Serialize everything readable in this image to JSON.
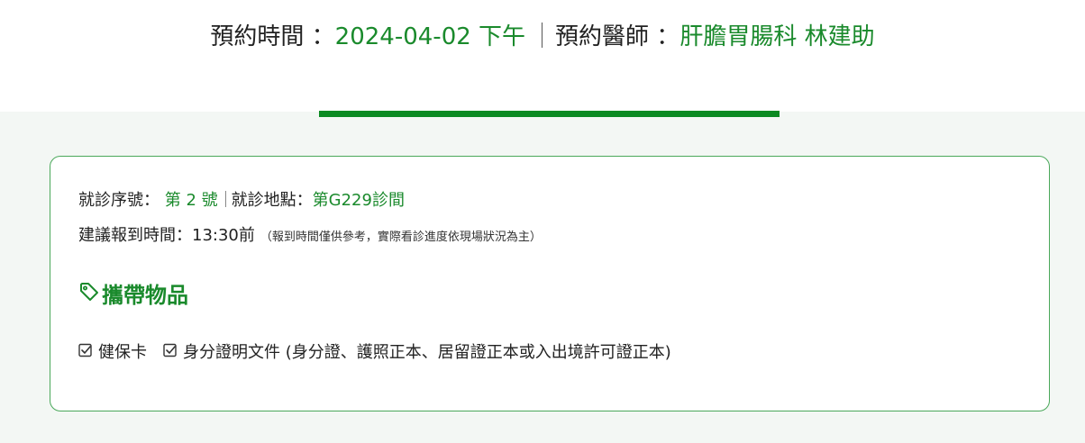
{
  "appointment": {
    "time_label": "預約時間 ：",
    "time_value": "2024-04-02 下午",
    "doctor_label": "預約醫師 ：",
    "doctor_value": "肝膽胃腸科 林建助"
  },
  "visit": {
    "number_label": "就診序號：",
    "number_value": "第 2 號",
    "location_label": "就診地點：",
    "location_value": "第G229診間",
    "checkin_label": "建議報到時間：",
    "checkin_value": "13:30前",
    "checkin_note": "（報到時間僅供參考，實際看診進度依現場狀況為主）"
  },
  "carry": {
    "title": "攜帶物品",
    "title_icon": "tag-icon",
    "items": [
      {
        "label": "健保卡",
        "icon": "checkbox-checked-icon"
      },
      {
        "label": "身分證明文件 (身分證、護照正本、居留證正本或入出境許可證正本)",
        "icon": "checkbox-checked-icon"
      }
    ]
  },
  "colors": {
    "accent": "#1a8a2c",
    "bar": "#0b8a22",
    "card_border": "#4aa85a",
    "background": "#f3f7f4"
  }
}
